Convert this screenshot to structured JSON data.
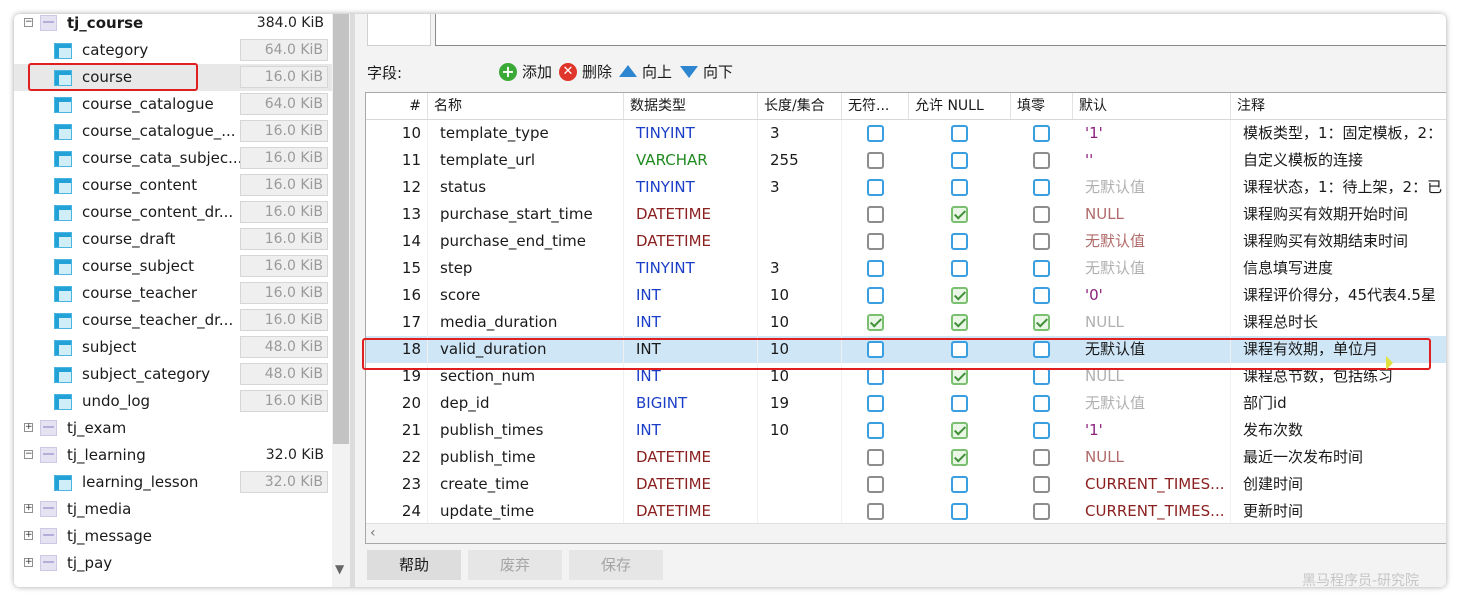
{
  "tree": {
    "items": [
      {
        "type": "db",
        "label": "tj_course",
        "size": "384.0 KiB",
        "expander": "−",
        "bold": true
      },
      {
        "type": "table",
        "label": "category",
        "size": "64.0 KiB"
      },
      {
        "type": "table",
        "label": "course",
        "size": "16.0 KiB",
        "selected": true
      },
      {
        "type": "table",
        "label": "course_catalogue",
        "size": "64.0 KiB"
      },
      {
        "type": "table",
        "label": "course_catalogue_...",
        "size": "16.0 KiB"
      },
      {
        "type": "table",
        "label": "course_cata_subjec...",
        "size": "16.0 KiB"
      },
      {
        "type": "table",
        "label": "course_content",
        "size": "16.0 KiB"
      },
      {
        "type": "table",
        "label": "course_content_dr...",
        "size": "16.0 KiB"
      },
      {
        "type": "table",
        "label": "course_draft",
        "size": "16.0 KiB"
      },
      {
        "type": "table",
        "label": "course_subject",
        "size": "16.0 KiB"
      },
      {
        "type": "table",
        "label": "course_teacher",
        "size": "16.0 KiB"
      },
      {
        "type": "table",
        "label": "course_teacher_dr...",
        "size": "16.0 KiB"
      },
      {
        "type": "table",
        "label": "subject",
        "size": "48.0 KiB"
      },
      {
        "type": "table",
        "label": "subject_category",
        "size": "48.0 KiB"
      },
      {
        "type": "table",
        "label": "undo_log",
        "size": "16.0 KiB"
      },
      {
        "type": "db",
        "label": "tj_exam",
        "size": "",
        "expander": "+"
      },
      {
        "type": "db",
        "label": "tj_learning",
        "size": "32.0 KiB",
        "expander": "−"
      },
      {
        "type": "table",
        "label": "learning_lesson",
        "size": "32.0 KiB"
      },
      {
        "type": "db",
        "label": "tj_media",
        "size": "",
        "expander": "+"
      },
      {
        "type": "db",
        "label": "tj_message",
        "size": "",
        "expander": "+"
      },
      {
        "type": "db",
        "label": "tj_pay",
        "size": "",
        "expander": "+"
      }
    ]
  },
  "toolbar": {
    "field_label": "字段:",
    "add_label": "添加",
    "delete_label": "删除",
    "up_label": "向上",
    "down_label": "向下"
  },
  "grid": {
    "headers": [
      "#",
      "名称",
      "数据类型",
      "长度/集合",
      "无符...",
      "允许 NULL",
      "填零",
      "默认",
      "注释"
    ],
    "rows": [
      {
        "num": "10",
        "name": "template_type",
        "type": "TINYINT",
        "typeColor": "#1a3ec8",
        "len": "3",
        "unsigned": {
          "style": "blue",
          "checked": false
        },
        "nullable": {
          "style": "blue",
          "checked": false
        },
        "zerofill": {
          "style": "blue",
          "checked": false
        },
        "default": "'1'",
        "defaultColor": "#8b1f7c",
        "comment": "模板类型，1：固定模板，2："
      },
      {
        "num": "11",
        "name": "template_url",
        "type": "VARCHAR",
        "typeColor": "#1f8a1f",
        "len": "255",
        "unsigned": {
          "style": "gray",
          "checked": false
        },
        "nullable": {
          "style": "blue",
          "checked": false
        },
        "zerofill": {
          "style": "gray",
          "checked": false
        },
        "default": "''",
        "defaultColor": "#8b1f7c",
        "comment": "自定义模板的连接"
      },
      {
        "num": "12",
        "name": "status",
        "type": "TINYINT",
        "typeColor": "#1a3ec8",
        "len": "3",
        "unsigned": {
          "style": "blue",
          "checked": false
        },
        "nullable": {
          "style": "blue",
          "checked": false
        },
        "zerofill": {
          "style": "blue",
          "checked": false
        },
        "default": "无默认值",
        "defaultColor": "#b0b0b0",
        "comment": "课程状态，1：待上架，2：已"
      },
      {
        "num": "13",
        "name": "purchase_start_time",
        "type": "DATETIME",
        "typeColor": "#8b2020",
        "len": "",
        "unsigned": {
          "style": "gray",
          "checked": false
        },
        "nullable": {
          "style": "green",
          "checked": true
        },
        "zerofill": {
          "style": "gray",
          "checked": false
        },
        "default": "NULL",
        "defaultColor": "#b06a6a",
        "comment": "课程购买有效期开始时间"
      },
      {
        "num": "14",
        "name": "purchase_end_time",
        "type": "DATETIME",
        "typeColor": "#8b2020",
        "len": "",
        "unsigned": {
          "style": "gray",
          "checked": false
        },
        "nullable": {
          "style": "blue",
          "checked": false
        },
        "zerofill": {
          "style": "gray",
          "checked": false
        },
        "default": "无默认值",
        "defaultColor": "#b06a6a",
        "comment": "课程购买有效期结束时间"
      },
      {
        "num": "15",
        "name": "step",
        "type": "TINYINT",
        "typeColor": "#1a3ec8",
        "len": "3",
        "unsigned": {
          "style": "blue",
          "checked": false
        },
        "nullable": {
          "style": "blue",
          "checked": false
        },
        "zerofill": {
          "style": "blue",
          "checked": false
        },
        "default": "无默认值",
        "defaultColor": "#b0b0b0",
        "comment": "信息填写进度"
      },
      {
        "num": "16",
        "name": "score",
        "type": "INT",
        "typeColor": "#1a3ec8",
        "len": "10",
        "unsigned": {
          "style": "blue",
          "checked": false
        },
        "nullable": {
          "style": "green",
          "checked": true
        },
        "zerofill": {
          "style": "blue",
          "checked": false
        },
        "default": "'0'",
        "defaultColor": "#8b1f7c",
        "comment": "课程评价得分，45代表4.5星"
      },
      {
        "num": "17",
        "name": "media_duration",
        "type": "INT",
        "typeColor": "#1a3ec8",
        "len": "10",
        "unsigned": {
          "style": "green",
          "checked": true
        },
        "nullable": {
          "style": "green",
          "checked": true
        },
        "zerofill": {
          "style": "green",
          "checked": true
        },
        "default": "NULL",
        "defaultColor": "#b0b0b0",
        "comment": "课程总时长"
      },
      {
        "num": "18",
        "name": "valid_duration",
        "type": "INT",
        "typeColor": "#1a1a1a",
        "len": "10",
        "unsigned": {
          "style": "blue",
          "checked": false
        },
        "nullable": {
          "style": "blue",
          "checked": false
        },
        "zerofill": {
          "style": "blue",
          "checked": false
        },
        "default": "无默认值",
        "defaultColor": "#1a1a1a",
        "comment": "课程有效期，单位月",
        "selected": true
      },
      {
        "num": "19",
        "name": "section_num",
        "type": "INT",
        "typeColor": "#1a3ec8",
        "len": "10",
        "unsigned": {
          "style": "blue",
          "checked": false
        },
        "nullable": {
          "style": "green",
          "checked": true
        },
        "zerofill": {
          "style": "blue",
          "checked": false
        },
        "default": "NULL",
        "defaultColor": "#b0b0b0",
        "comment": "课程总节数，包括练习"
      },
      {
        "num": "20",
        "name": "dep_id",
        "type": "BIGINT",
        "typeColor": "#1a3ec8",
        "len": "19",
        "unsigned": {
          "style": "blue",
          "checked": false
        },
        "nullable": {
          "style": "blue",
          "checked": false
        },
        "zerofill": {
          "style": "blue",
          "checked": false
        },
        "default": "无默认值",
        "defaultColor": "#b0b0b0",
        "comment": "部门id"
      },
      {
        "num": "21",
        "name": "publish_times",
        "type": "INT",
        "typeColor": "#1a3ec8",
        "len": "10",
        "unsigned": {
          "style": "blue",
          "checked": false
        },
        "nullable": {
          "style": "green",
          "checked": true
        },
        "zerofill": {
          "style": "blue",
          "checked": false
        },
        "default": "'1'",
        "defaultColor": "#8b1f7c",
        "comment": "发布次数"
      },
      {
        "num": "22",
        "name": "publish_time",
        "type": "DATETIME",
        "typeColor": "#8b2020",
        "len": "",
        "unsigned": {
          "style": "gray",
          "checked": false
        },
        "nullable": {
          "style": "green",
          "checked": true
        },
        "zerofill": {
          "style": "gray",
          "checked": false
        },
        "default": "NULL",
        "defaultColor": "#b06a6a",
        "comment": "最近一次发布时间"
      },
      {
        "num": "23",
        "name": "create_time",
        "type": "DATETIME",
        "typeColor": "#8b2020",
        "len": "",
        "unsigned": {
          "style": "gray",
          "checked": false
        },
        "nullable": {
          "style": "blue",
          "checked": false
        },
        "zerofill": {
          "style": "gray",
          "checked": false
        },
        "default": "CURRENT_TIMES...",
        "defaultColor": "#8b2020",
        "comment": "创建时间"
      },
      {
        "num": "24",
        "name": "update_time",
        "type": "DATETIME",
        "typeColor": "#8b2020",
        "len": "",
        "unsigned": {
          "style": "gray",
          "checked": false
        },
        "nullable": {
          "style": "blue",
          "checked": false
        },
        "zerofill": {
          "style": "gray",
          "checked": false
        },
        "default": "CURRENT_TIMES...",
        "defaultColor": "#8b2020",
        "comment": "更新时间"
      }
    ]
  },
  "buttons": {
    "help": "帮助",
    "discard": "废弃",
    "save": "保存"
  },
  "watermark": "黑马程序员-研究院",
  "colors": {
    "selected_row": "#cfe6f7",
    "highlight_border": "#e02020",
    "add_icon": "#3aa935",
    "delete_icon": "#e0352b",
    "arrow_icon": "#2e86d0"
  }
}
